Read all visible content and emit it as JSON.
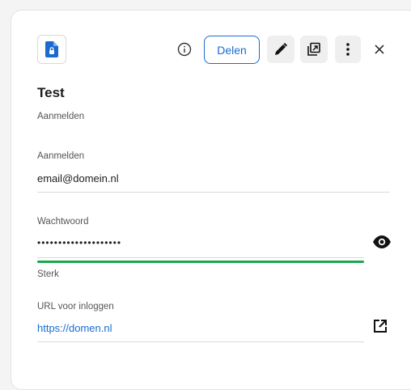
{
  "header": {
    "share_label": "Delen",
    "icons": {
      "app": "lock-file-icon",
      "info": "info-icon",
      "edit": "pencil-icon",
      "duplicate": "duplicate-icon",
      "more": "more-vertical-icon",
      "close": "close-icon",
      "eye": "eye-icon",
      "external": "external-link-icon"
    }
  },
  "item": {
    "title": "Test",
    "subtitle": "Aanmelden"
  },
  "fields": {
    "login": {
      "label": "Aanmelden",
      "value": "email@domein.nl"
    },
    "password": {
      "label": "Wachtwoord",
      "value": "••••••••••••••••••••",
      "strength_label": "Sterk",
      "strength_fraction": 1.0
    },
    "url": {
      "label": "URL voor inloggen",
      "value": "https://domen.nl"
    }
  },
  "colors": {
    "accent": "#1a6bd1",
    "strength": "#1aa84a"
  }
}
